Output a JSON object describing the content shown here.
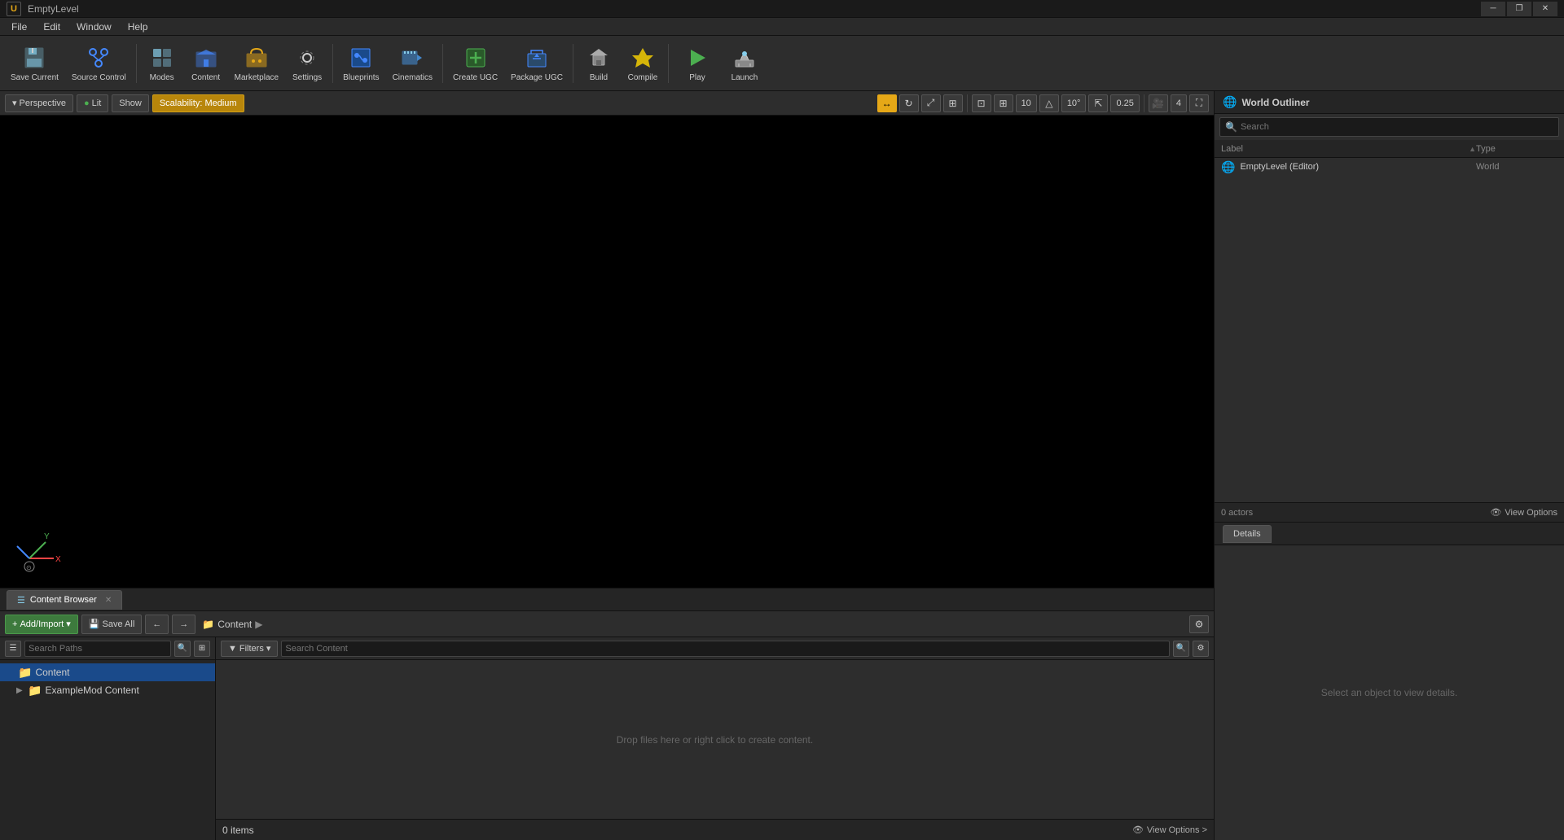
{
  "titlebar": {
    "logo": "U",
    "title": "EmptyLevel",
    "minimize_label": "─",
    "restore_label": "❐",
    "close_label": "✕"
  },
  "menubar": {
    "items": [
      "File",
      "Edit",
      "Window",
      "Help"
    ]
  },
  "toolbar": {
    "buttons": [
      {
        "id": "save-current",
        "label": "Save Current",
        "icon": "💾"
      },
      {
        "id": "source-control",
        "label": "Source Control",
        "icon": "🔀"
      },
      {
        "id": "modes",
        "label": "Modes",
        "icon": "🔧"
      },
      {
        "id": "content",
        "label": "Content",
        "icon": "📦"
      },
      {
        "id": "marketplace",
        "label": "Marketplace",
        "icon": "🛒"
      },
      {
        "id": "settings",
        "label": "Settings",
        "icon": "⚙️"
      },
      {
        "id": "blueprints",
        "label": "Blueprints",
        "icon": "📋"
      },
      {
        "id": "cinematics",
        "label": "Cinematics",
        "icon": "🎬"
      },
      {
        "id": "create-ugc",
        "label": "Create UGC",
        "icon": "➕"
      },
      {
        "id": "package-ugc",
        "label": "Package UGC",
        "icon": "📤"
      },
      {
        "id": "build",
        "label": "Build",
        "icon": "🔨"
      },
      {
        "id": "compile",
        "label": "Compile",
        "icon": "⚡"
      },
      {
        "id": "play",
        "label": "Play",
        "icon": "▶"
      },
      {
        "id": "launch",
        "label": "Launch",
        "icon": "🚀"
      }
    ]
  },
  "viewport": {
    "perspective_label": "Perspective",
    "lit_label": "Lit",
    "show_label": "Show",
    "scalability_label": "Scalability: Medium",
    "grid_value": "10",
    "rotation_value": "10°",
    "scale_value": "0.25",
    "camera_value": "4"
  },
  "world_outliner": {
    "title": "World Outliner",
    "search_placeholder": "Search",
    "col_label": "Label",
    "col_type": "Type",
    "actors_count": "0 actors",
    "view_options_label": "View Options",
    "items": [
      {
        "label": "EmptyLevel (Editor)",
        "type": "World",
        "icon": "🌐"
      }
    ]
  },
  "details": {
    "tab_label": "Details",
    "empty_message": "Select an object to view details."
  },
  "content_browser": {
    "tab_label": "Content Browser",
    "add_import_label": "Add/Import ▾",
    "save_all_label": "Save All",
    "breadcrumb_root": "Content",
    "search_paths_placeholder": "Search Paths",
    "filters_label": "▼ Filters ▾",
    "search_placeholder": "Search Content",
    "drop_message": "Drop files here or right click to create content.",
    "items_count": "0 items",
    "view_options_label": "View Options >",
    "tree_items": [
      {
        "label": "Content",
        "selected": true,
        "expanded": false,
        "has_children": false
      },
      {
        "label": "ExampleMod Content",
        "selected": false,
        "expanded": false,
        "has_children": true
      }
    ]
  }
}
